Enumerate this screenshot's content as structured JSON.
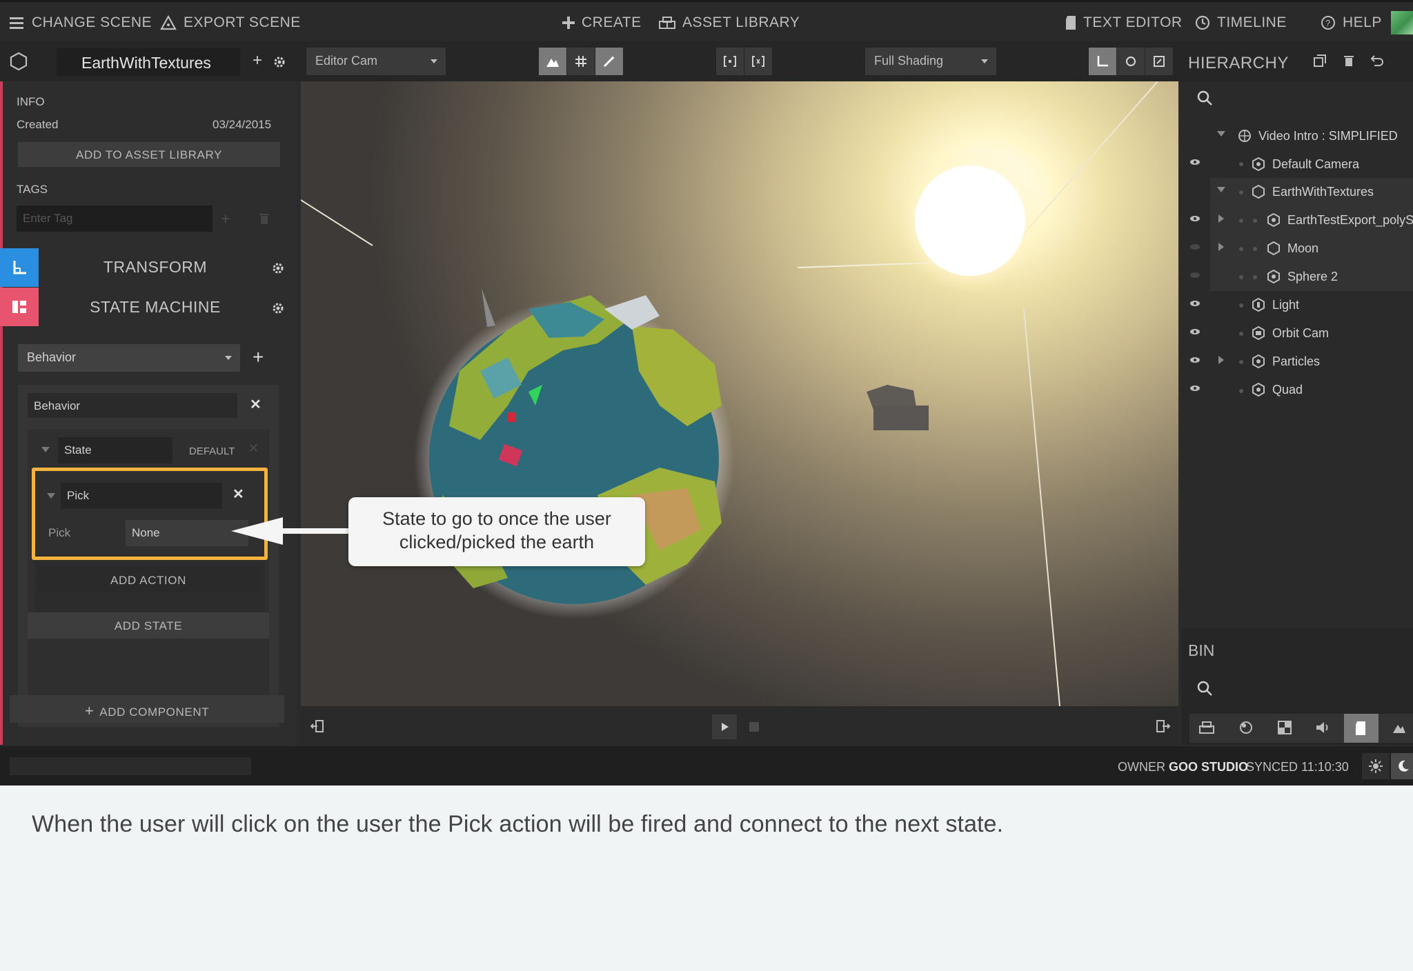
{
  "topbar": {
    "change_scene": "CHANGE SCENE",
    "export_scene": "EXPORT SCENE",
    "create": "CREATE",
    "asset_library": "ASSET LIBRARY",
    "text_editor": "TEXT EDITOR",
    "timeline": "TIMELINE",
    "help": "HELP"
  },
  "toolbar": {
    "scene_name": "EarthWithTextures",
    "camera_select": "Editor Cam",
    "shading_select": "Full Shading"
  },
  "inspector": {
    "info_label": "INFO",
    "created_label": "Created",
    "created_date": "03/24/2015",
    "add_to_asset_library": "ADD TO ASSET LIBRARY",
    "tags_label": "TAGS",
    "tag_placeholder": "Enter Tag",
    "transform_title": "TRANSFORM",
    "state_machine_title": "STATE MACHINE",
    "behavior_select": "Behavior",
    "behavior_name": "Behavior",
    "state_name": "State",
    "state_default_badge": "DEFAULT",
    "action_name": "Pick",
    "action_param_label": "Pick",
    "action_param_value": "None",
    "add_action": "ADD ACTION",
    "add_state": "ADD STATE",
    "add_component": "ADD COMPONENT"
  },
  "hierarchy": {
    "title": "HIERARCHY",
    "items": [
      {
        "label": "Video Intro : SIMPLIFIED"
      },
      {
        "label": "Default Camera"
      },
      {
        "label": "EarthWithTextures"
      },
      {
        "label": "EarthTestExport_polyS"
      },
      {
        "label": "Moon"
      },
      {
        "label": "Sphere 2"
      },
      {
        "label": "Light"
      },
      {
        "label": "Orbit Cam"
      },
      {
        "label": "Particles"
      },
      {
        "label": "Quad"
      }
    ],
    "bin_title": "BIN"
  },
  "status": {
    "owner_label": "OWNER",
    "owner_name": "GOO STUDIO",
    "synced": "SYNCED 11:10:30"
  },
  "annotation": {
    "callout_line1": "State to go to once the user",
    "callout_line2": "clicked/picked the earth",
    "highlight_color": "#f3b33d"
  },
  "caption": "When the user will click on the user the Pick action will be fired and connect to the next state.",
  "colors": {
    "accent_red": "#d03b57",
    "tab_blue": "#2a8fe0",
    "tab_pink": "#e8546e"
  }
}
